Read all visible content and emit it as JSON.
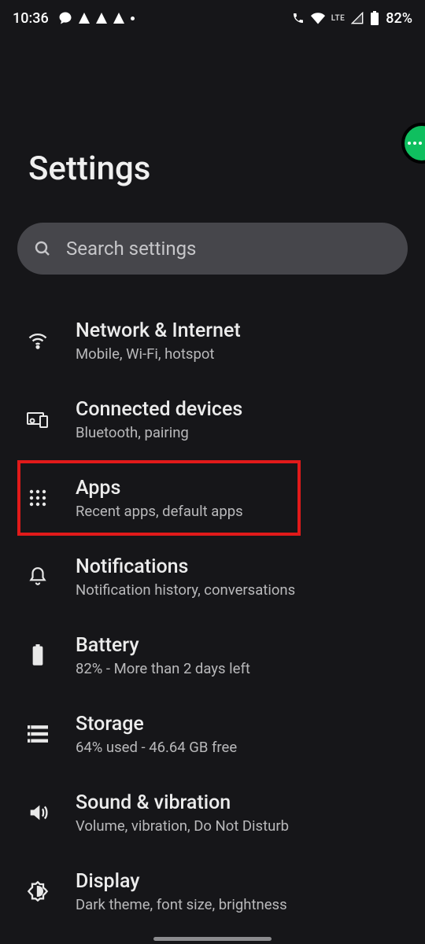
{
  "status": {
    "time": "10:36",
    "lte": "LTE",
    "battery": "82%"
  },
  "fab_label": "more",
  "page_title": "Settings",
  "search": {
    "placeholder": "Search settings"
  },
  "items": {
    "network": {
      "title": "Network & Internet",
      "sub": "Mobile, Wi-Fi, hotspot"
    },
    "devices": {
      "title": "Connected devices",
      "sub": "Bluetooth, pairing"
    },
    "apps": {
      "title": "Apps",
      "sub": "Recent apps, default apps"
    },
    "notif": {
      "title": "Notifications",
      "sub": "Notification history, conversations"
    },
    "battery": {
      "title": "Battery",
      "sub": "82% - More than 2 days left"
    },
    "storage": {
      "title": "Storage",
      "sub": "64% used - 46.64 GB free"
    },
    "sound": {
      "title": "Sound & vibration",
      "sub": "Volume, vibration, Do Not Disturb"
    },
    "display": {
      "title": "Display",
      "sub": "Dark theme, font size, brightness"
    }
  }
}
